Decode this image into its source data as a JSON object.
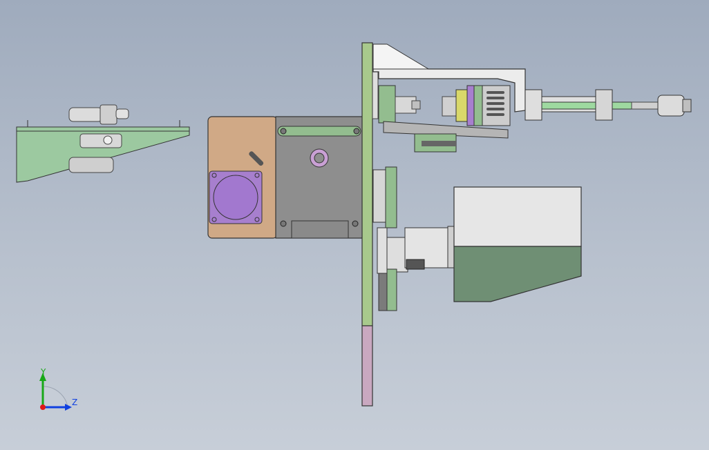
{
  "scene": {
    "background_top": "#9fabbd",
    "background_bottom": "#c7ced8",
    "parts": {
      "motor_housing": "#d0a986",
      "gearbox": "#8e8e8e",
      "flange": "#a77fce",
      "plate_green": "#93bd8f",
      "plate_pink": "#c9a8c0",
      "bracket_white": "#ececec",
      "block_grey": "#e6e6e6",
      "block_dark": "#6f8f74",
      "cylinder_yellow": "#d9d86a",
      "rod_green": "#9ed9a0"
    }
  },
  "triad": {
    "axis_y": "Y",
    "axis_z": "Z",
    "y_color": "#18a818",
    "z_color": "#1040e0",
    "origin_color": "#e01818"
  }
}
